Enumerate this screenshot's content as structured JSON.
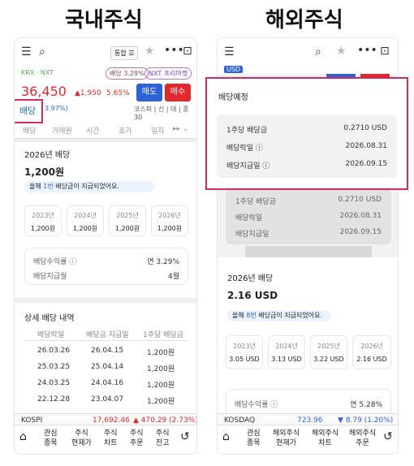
{
  "left_title": "국내주식",
  "right_title": "해외주식",
  "left": {
    "combine_btn": "통합",
    "market": "KRX · NXT",
    "dividend_badge": "배당 3.29%",
    "nxt_badge": "NXT 프리마켓",
    "price": "36,450",
    "change": "▲1,950",
    "change_pct": "5.65%",
    "sell": "매도",
    "buy": "매수",
    "dividend_tab_hl": "배당",
    "pct_small": "3.97%)",
    "kospi_info": "코스피 | 신 | 대 | 종 30",
    "tabs": [
      "배당",
      "거래원",
      "시간",
      "호가",
      "일자"
    ],
    "year_header": "2026년 배당",
    "year_amount": "1,200원",
    "year_note_pre": "올해 ",
    "year_note_hl": "1번",
    "year_note_post": " 배당금이 지급되었어요.",
    "years": [
      {
        "y": "2023년",
        "v": "1,200원"
      },
      {
        "y": "2024년",
        "v": "1,200원"
      },
      {
        "y": "2025년",
        "v": "1,200원"
      },
      {
        "y": "2026년",
        "v": "1,200원"
      }
    ],
    "yield_label": "배당수익률",
    "yield_value": "연 3.29%",
    "paymonth_label": "배당지급월",
    "paymonth_value": "4월",
    "detail_title": "상세 배당 내역",
    "detail_headers": [
      "배당락일",
      "배당금 지급일",
      "1주당 배당금"
    ],
    "detail_rows": [
      [
        "26.03.26",
        "26.04.15",
        "1,200원"
      ],
      [
        "25.03.25",
        "25.04.14",
        "1,200원"
      ],
      [
        "24.03.25",
        "24.04.16",
        "1,200원"
      ],
      [
        "22.12.28",
        "23.04.07",
        "1,200원"
      ]
    ],
    "index_name": "KOSPI",
    "index_value": "17,692.46",
    "index_change": "▲ 470.29 (2.73%)",
    "nav": [
      "관심\n종목",
      "주식\n현재가",
      "주식\n차트",
      "주식\n주문",
      "주식\n잔고"
    ]
  },
  "right": {
    "usd_tag": "USD",
    "popup_title": "배당예정",
    "rows": [
      {
        "label": "1주당 배당금",
        "value": "0.2710 USD"
      },
      {
        "label": "배당락일",
        "value": "2026.08.31"
      },
      {
        "label": "배당지급일",
        "value": "2026.09.15"
      }
    ],
    "year_header": "2026년 배당",
    "year_amount": "2.16 USD",
    "year_note_pre": "올해 ",
    "year_note_hl": "8번",
    "year_note_post": " 배당금이 지급되었어요.",
    "years": [
      {
        "y": "2023년",
        "v": "3.05 USD"
      },
      {
        "y": "2024년",
        "v": "3.13 USD"
      },
      {
        "y": "2025년",
        "v": "3.22 USD"
      },
      {
        "y": "2026년",
        "v": "2.16 USD"
      }
    ],
    "yield_label": "배당수익률",
    "yield_value": "연 5.28%",
    "index_name": "KOSDAQ",
    "index_value": "723.96",
    "index_change": "▼ 8.79 (1.20%)",
    "nav": [
      "관심\n종목",
      "해외주식\n현재가",
      "해외주식\n차트",
      "해외주식\n주문"
    ]
  },
  "colors": {
    "up": "#e0292d",
    "down": "#1f5bd6",
    "highlight": "#d6295d",
    "buy": "#e0292d",
    "sell": "#2f62d6",
    "note": "#2f62d6"
  }
}
